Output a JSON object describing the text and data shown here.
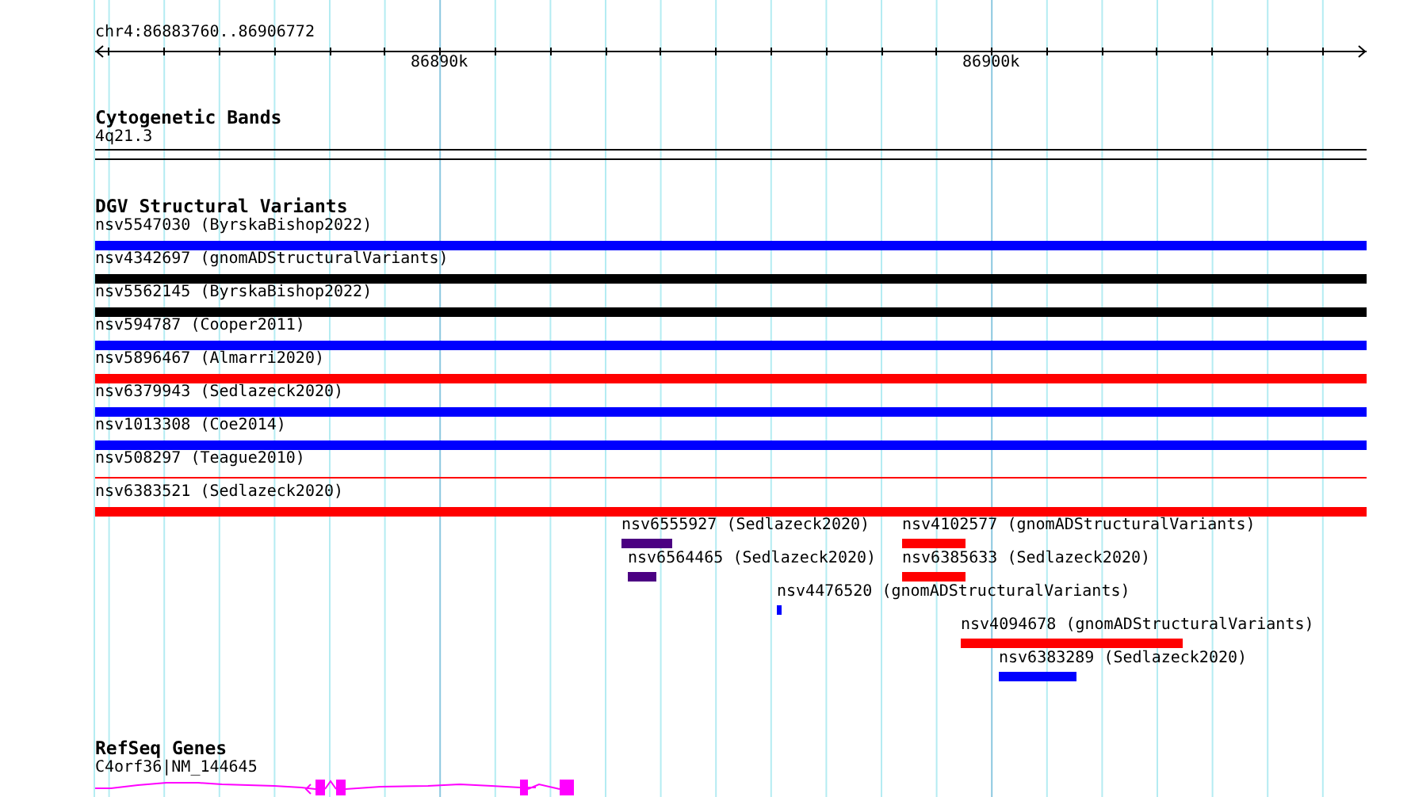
{
  "position": "chr4:86883760..86906772",
  "ruler": {
    "tick_labels": [
      "86890k",
      "86900k"
    ]
  },
  "cytoband_track": {
    "title": "Cytogenetic Bands",
    "band": "4q21.3"
  },
  "dgv_track": {
    "title": "DGV Structural Variants",
    "features": [
      {
        "label": "nsv5547030 (ByrskaBishop2022)",
        "color": "#0000ff",
        "kind": "thick"
      },
      {
        "label": "nsv4342697 (gnomADStructuralVariants)",
        "color": "#000000",
        "kind": "thick"
      },
      {
        "label": "nsv5562145 (ByrskaBishop2022)",
        "color": "#000000",
        "kind": "thick"
      },
      {
        "label": "nsv594787 (Cooper2011)",
        "color": "#0000ff",
        "kind": "thick"
      },
      {
        "label": "nsv5896467 (Almarri2020)",
        "color": "#ff0000",
        "kind": "thick"
      },
      {
        "label": "nsv6379943 (Sedlazeck2020)",
        "color": "#0000ff",
        "kind": "thick"
      },
      {
        "label": "nsv1013308 (Coe2014)",
        "color": "#0000ff",
        "kind": "thick"
      },
      {
        "label": "nsv508297 (Teague2010)",
        "color": "#ff0000",
        "kind": "thin"
      },
      {
        "label": "nsv6383521 (Sedlazeck2020)",
        "color": "#ff0000",
        "kind": "thick"
      }
    ],
    "short_features": [
      {
        "label": "nsv6555927 (Sedlazeck2020)",
        "color": "#4b0082"
      },
      {
        "label": "nsv4102577 (gnomADStructuralVariants)",
        "color": "#ff0000"
      },
      {
        "label": "nsv6564465 (Sedlazeck2020)",
        "color": "#4b0082"
      },
      {
        "label": "nsv6385633 (Sedlazeck2020)",
        "color": "#ff0000"
      },
      {
        "label": "nsv4476520 (gnomADStructuralVariants)",
        "color": "#0000ff"
      },
      {
        "label": "nsv4094678 (gnomADStructuralVariants)",
        "color": "#ff0000"
      },
      {
        "label": "nsv6383289 (Sedlazeck2020)",
        "color": "#0000ff"
      }
    ]
  },
  "refseq_track": {
    "title": "RefSeq Genes",
    "gene": "C4orf36|NM_144645"
  }
}
